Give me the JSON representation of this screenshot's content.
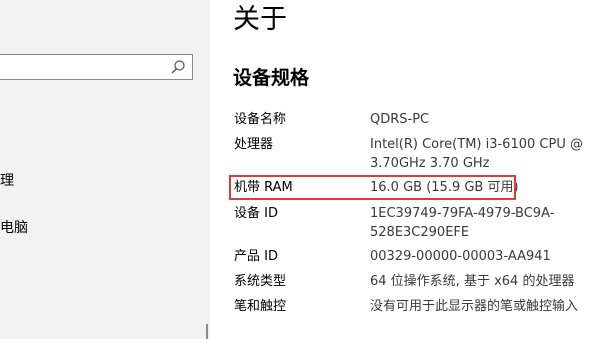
{
  "sidebar": {
    "search": {
      "placeholder": ""
    },
    "items": [
      {
        "label": "理"
      },
      {
        "label": "电脑"
      }
    ]
  },
  "main": {
    "title": "关于",
    "section_title": "设备规格",
    "specs": [
      {
        "label": "设备名称",
        "value": "QDRS-PC"
      },
      {
        "label": "处理器",
        "value": "Intel(R) Core(TM) i3-6100 CPU @ 3.70GHz   3.70 GHz"
      },
      {
        "label": "机带 RAM",
        "value": "16.0 GB (15.9 GB 可用)"
      },
      {
        "label": "设备 ID",
        "value": "1EC39749-79FA-4979-BC9A-528E3C290EFE"
      },
      {
        "label": "产品 ID",
        "value": "00329-00000-00003-AA941"
      },
      {
        "label": "系统类型",
        "value": "64 位操作系统, 基于 x64 的处理器"
      },
      {
        "label": "笔和触控",
        "value": "没有可用于此显示器的笔或触控输入"
      }
    ]
  },
  "colors": {
    "highlight": "#e03a3a",
    "sidebar_bg": "#f2f2f2",
    "value_text": "#3a3a3a"
  }
}
